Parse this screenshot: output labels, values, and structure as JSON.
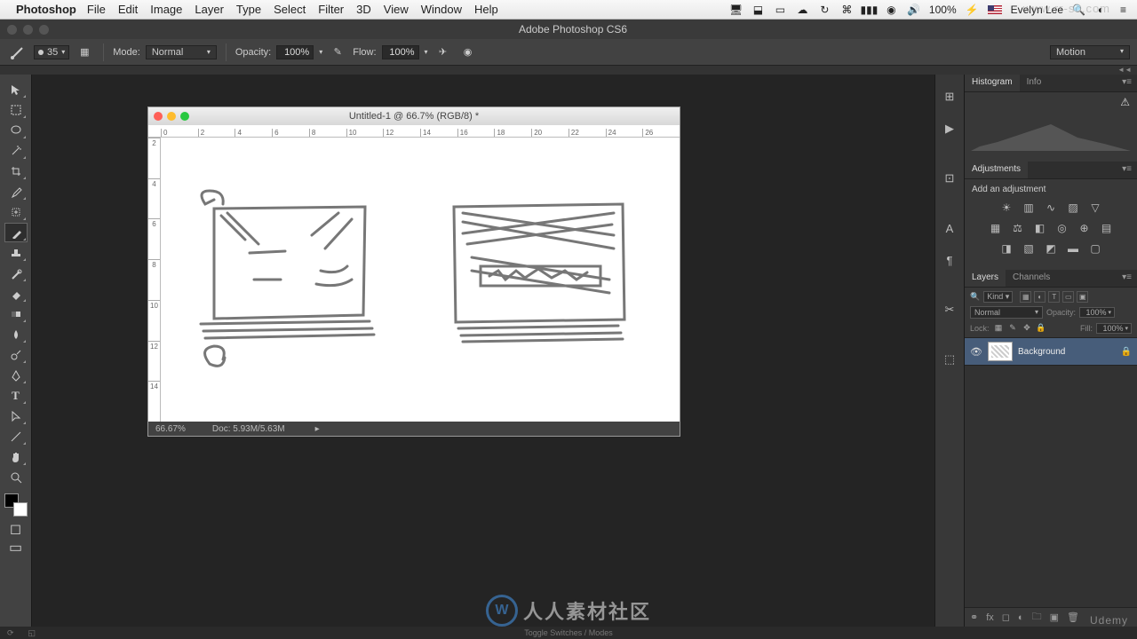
{
  "menubar": {
    "app": "Photoshop",
    "items": [
      "File",
      "Edit",
      "Image",
      "Layer",
      "Type",
      "Select",
      "Filter",
      "3D",
      "View",
      "Window",
      "Help"
    ],
    "status": {
      "battery_pct": "100%",
      "user": "Evelyn Lee"
    }
  },
  "titlebar": {
    "title": "Adobe Photoshop CS6"
  },
  "options": {
    "brush_size": "35",
    "mode_label": "Mode:",
    "mode_value": "Normal",
    "opacity_label": "Opacity:",
    "opacity_value": "100%",
    "flow_label": "Flow:",
    "flow_value": "100%",
    "workspace": "Motion"
  },
  "document": {
    "title": "Untitled-1 @ 66.7% (RGB/8) *",
    "zoom": "66.67%",
    "doc_size": "Doc: 5.93M/5.63M",
    "ruler_h": [
      "0",
      "2",
      "4",
      "6",
      "8",
      "10",
      "12",
      "14",
      "16",
      "18",
      "20",
      "22",
      "24",
      "26"
    ],
    "ruler_v": [
      "2",
      "4",
      "6",
      "8",
      "10",
      "12",
      "14"
    ]
  },
  "panels": {
    "histogram": {
      "tabs": [
        "Histogram",
        "Info"
      ]
    },
    "adjustments": {
      "title": "Adjustments",
      "label": "Add an adjustment"
    },
    "layers": {
      "tabs": [
        "Layers",
        "Channels"
      ],
      "kind": "Kind",
      "blend_mode": "Normal",
      "opacity_label": "Opacity:",
      "opacity_value": "100%",
      "lock_label": "Lock:",
      "fill_label": "Fill:",
      "fill_value": "100%",
      "rows": [
        {
          "name": "Background"
        }
      ]
    }
  },
  "bottom": {
    "toggle": "Toggle Switches / Modes"
  },
  "watermark": {
    "site": "人人素材社区",
    "brand": "Udemy",
    "top": "www.rr-sc.com"
  }
}
